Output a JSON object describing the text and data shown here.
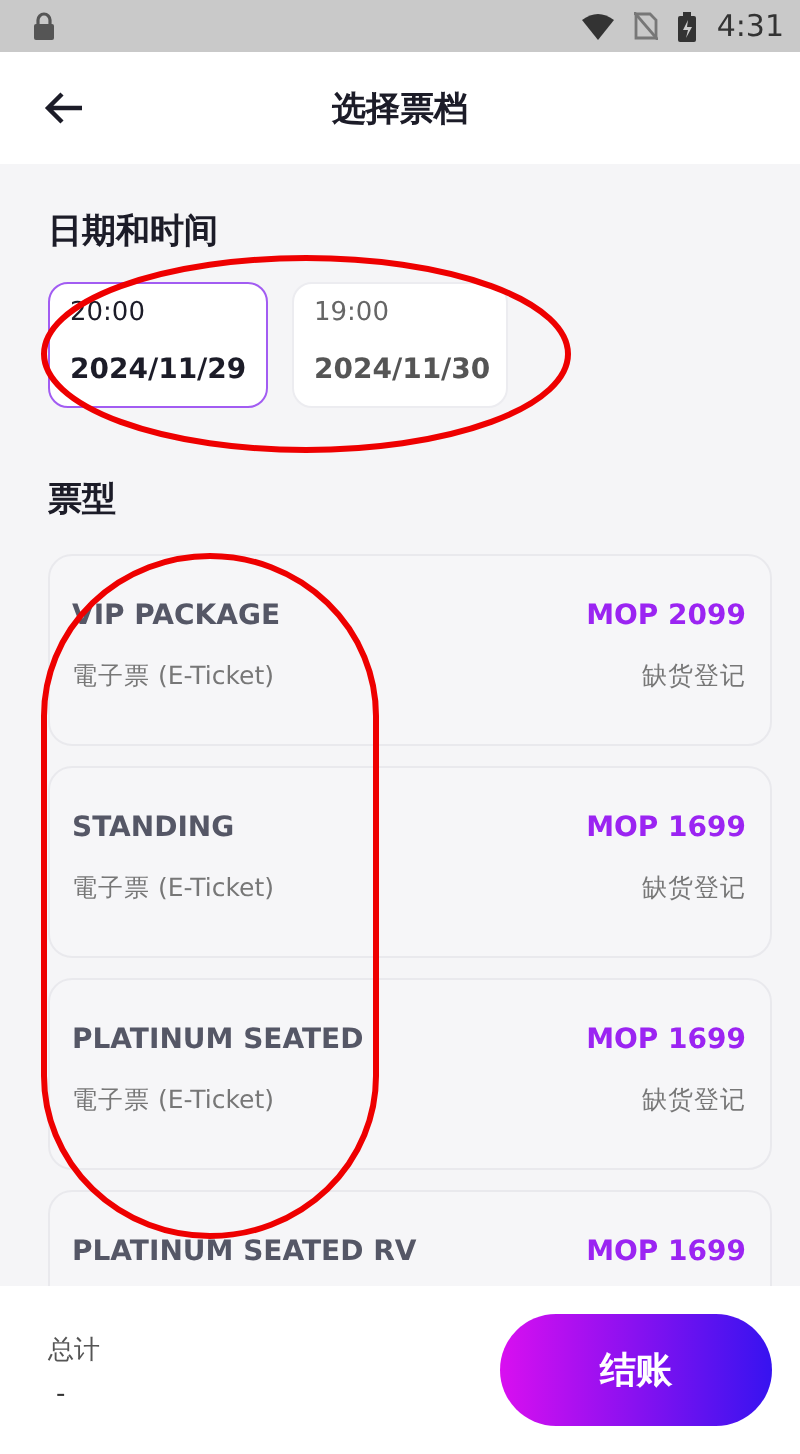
{
  "status_bar": {
    "time": "4:31"
  },
  "header": {
    "title": "选择票档"
  },
  "dates": {
    "title": "日期和时间",
    "circled": true,
    "options": [
      {
        "time": "20:00",
        "date": "2024/11/29",
        "selected": true
      },
      {
        "time": "19:00",
        "date": "2024/11/30",
        "selected": false
      }
    ]
  },
  "tickets": {
    "title": "票型",
    "circled": true,
    "items": [
      {
        "name": "VIP PACKAGE",
        "type": "電子票 (E-Ticket)",
        "price": "MOP 2099",
        "status": "缺货登记"
      },
      {
        "name": "STANDING",
        "type": "電子票 (E-Ticket)",
        "price": "MOP 1699",
        "status": "缺货登记"
      },
      {
        "name": "PLATINUM SEATED",
        "type": "電子票 (E-Ticket)",
        "price": "MOP 1699",
        "status": "缺货登记"
      },
      {
        "name": "PLATINUM SEATED RV",
        "price": "MOP 1699"
      }
    ]
  },
  "footer": {
    "total_label": "总计",
    "total": "-",
    "checkout": "结账"
  }
}
